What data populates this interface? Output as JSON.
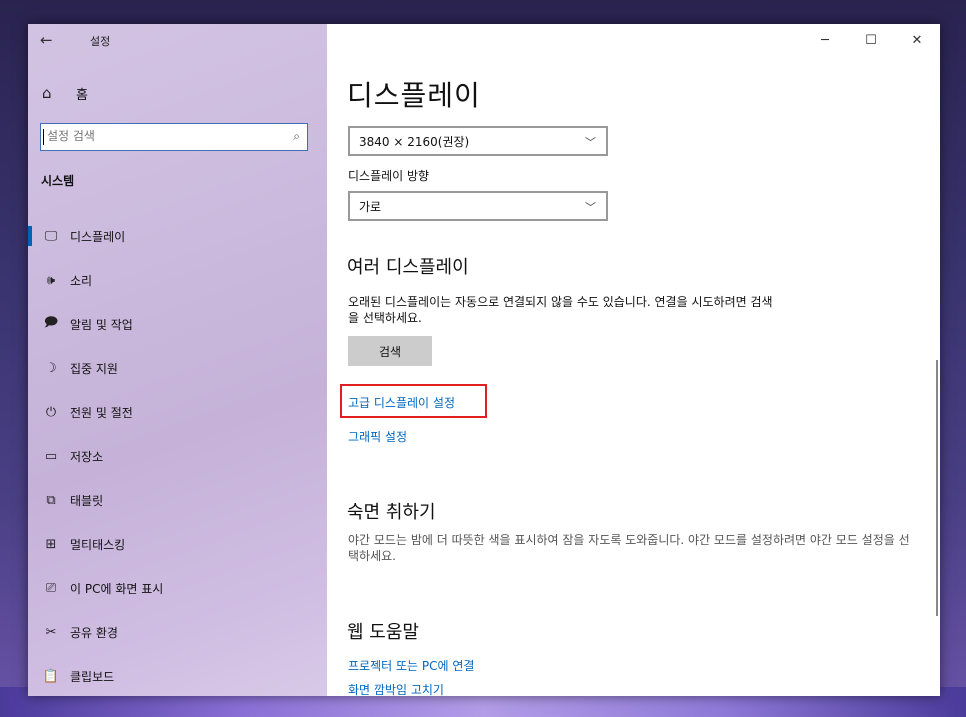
{
  "window": {
    "app_title": "설정",
    "back_icon": "back-arrow-icon",
    "controls": {
      "minimize": "─",
      "maximize": "☐",
      "close": "✕"
    }
  },
  "sidebar": {
    "home_label": "홈",
    "search_placeholder": "설정 검색",
    "section_title": "시스템",
    "items": [
      {
        "label": "디스플레이",
        "icon": "monitor-icon",
        "glyph": "🖵",
        "active": true
      },
      {
        "label": "소리",
        "icon": "speaker-icon",
        "glyph": "🕪"
      },
      {
        "label": "알림 및 작업",
        "icon": "notification-icon",
        "glyph": "🗩"
      },
      {
        "label": "집중 지원",
        "icon": "moon-icon",
        "glyph": "☽"
      },
      {
        "label": "전원 및 절전",
        "icon": "power-icon",
        "glyph": "⏻"
      },
      {
        "label": "저장소",
        "icon": "storage-icon",
        "glyph": "▭"
      },
      {
        "label": "태블릿",
        "icon": "tablet-icon",
        "glyph": "⧉"
      },
      {
        "label": "멀티태스킹",
        "icon": "multitasking-icon",
        "glyph": "⊞"
      },
      {
        "label": "이 PC에 화면 표시",
        "icon": "project-icon",
        "glyph": "⎚"
      },
      {
        "label": "공유 환경",
        "icon": "shared-experience-icon",
        "glyph": "✂"
      },
      {
        "label": "클립보드",
        "icon": "clipboard-icon",
        "glyph": "📋"
      }
    ]
  },
  "main": {
    "page_title": "디스플레이",
    "resolution_value": "3840 × 2160(권장)",
    "orientation_label": "디스플레이 방향",
    "orientation_value": "가로",
    "multi_display_heading": "여러 디스플레이",
    "multi_display_text": "오래된 디스플레이는 자동으로 연결되지 않을 수도 있습니다. 연결을 시도하려면 검색을 선택하세요.",
    "detect_button": "검색",
    "advanced_link": "고급 디스플레이 설정",
    "graphics_link": "그래픽 설정",
    "sleep_heading": "숙면 취하기",
    "sleep_text": "야간 모드는 밤에 더 따뜻한 색을 표시하여 잠을 자도록 도와줍니다. 야간 모드를 설정하려면 야간 모드 설정을 선택하세요.",
    "web_help_heading": "웹 도움말",
    "help_links": [
      "프로젝터 또는 PC에 연결",
      "화면 깜박임 고치기"
    ]
  },
  "colors": {
    "accent": "#0063b1",
    "link": "#0067c0",
    "highlight": "#e02020"
  }
}
